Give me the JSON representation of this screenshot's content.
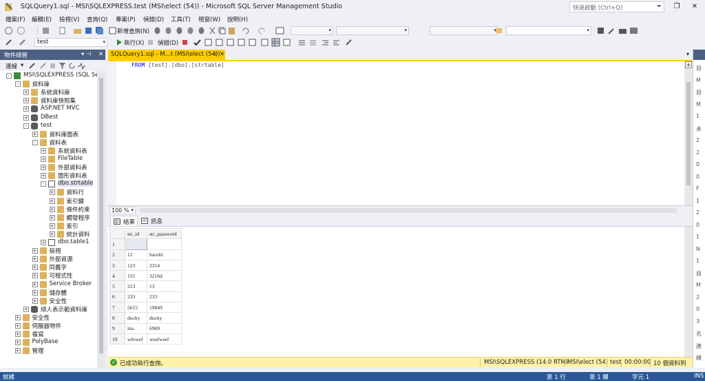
{
  "window": {
    "title": "SQLQuery1.sql - MSI\\SQLEXPRESS.test (MSI\\elect (54)) - Microsoft SQL Server Management Studio",
    "quick_launch_placeholder": "快速啟動 (Ctrl+Q)"
  },
  "menu": [
    "檔案(F)",
    "編輯(E)",
    "檢視(V)",
    "查詢(Q)",
    "專案(P)",
    "偵錯(D)",
    "工具(T)",
    "視窗(W)",
    "說明(H)"
  ],
  "toolbar1": {
    "new_query": "新增查詢(N)"
  },
  "toolbar2": {
    "database": "test",
    "execute": "執行(X)",
    "debug": "偵錯(D)"
  },
  "object_explorer": {
    "title": "物件總管",
    "connect": "連線",
    "tree": [
      {
        "label": "MSI\\SQLEXPRESS (SQL Server",
        "level": 0,
        "expander": "-",
        "icon": "server-icon"
      },
      {
        "label": "資料庫",
        "level": 1,
        "expander": "-",
        "icon": "folder-icon"
      },
      {
        "label": "系統資料庫",
        "level": 2,
        "expander": "+",
        "icon": "folder-icon"
      },
      {
        "label": "資料庫快照集",
        "level": 2,
        "expander": "+",
        "icon": "folder-icon"
      },
      {
        "label": "ASP.NET MVC",
        "level": 2,
        "expander": "+",
        "icon": "database-icon"
      },
      {
        "label": "DBest",
        "level": 2,
        "expander": "+",
        "icon": "database-icon"
      },
      {
        "label": "test",
        "level": 2,
        "expander": "-",
        "icon": "database-icon"
      },
      {
        "label": "資料庫圖表",
        "level": 3,
        "expander": "+",
        "icon": "folder-icon"
      },
      {
        "label": "資料表",
        "level": 3,
        "expander": "-",
        "icon": "folder-icon"
      },
      {
        "label": "系統資料表",
        "level": 4,
        "expander": "+",
        "icon": "folder-icon"
      },
      {
        "label": "FileTable",
        "level": 4,
        "expander": "+",
        "icon": "folder-icon"
      },
      {
        "label": "外部資料表",
        "level": 4,
        "expander": "+",
        "icon": "folder-icon"
      },
      {
        "label": "圖形資料表",
        "level": 4,
        "expander": "+",
        "icon": "folder-icon"
      },
      {
        "label": "dbo.strtable",
        "level": 4,
        "expander": "-",
        "icon": "table-icon",
        "selected": true
      },
      {
        "label": "資料行",
        "level": 5,
        "expander": "+",
        "icon": "folder-icon"
      },
      {
        "label": "索引鍵",
        "level": 5,
        "expander": "+",
        "icon": "folder-icon"
      },
      {
        "label": "條件約束",
        "level": 5,
        "expander": "+",
        "icon": "folder-icon"
      },
      {
        "label": "觸發程序",
        "level": 5,
        "expander": "+",
        "icon": "folder-icon"
      },
      {
        "label": "索引",
        "level": 5,
        "expander": "+",
        "icon": "folder-icon"
      },
      {
        "label": "統計資料",
        "level": 5,
        "expander": "+",
        "icon": "folder-icon"
      },
      {
        "label": "dbo.table1",
        "level": 4,
        "expander": "+",
        "icon": "table-icon"
      },
      {
        "label": "檢視",
        "level": 3,
        "expander": "+",
        "icon": "folder-icon"
      },
      {
        "label": "外部資源",
        "level": 3,
        "expander": "+",
        "icon": "folder-icon"
      },
      {
        "label": "同義字",
        "level": 3,
        "expander": "+",
        "icon": "folder-icon"
      },
      {
        "label": "可程式性",
        "level": 3,
        "expander": "+",
        "icon": "folder-icon"
      },
      {
        "label": "Service Broker",
        "level": 3,
        "expander": "+",
        "icon": "folder-icon"
      },
      {
        "label": "儲存體",
        "level": 3,
        "expander": "+",
        "icon": "folder-icon"
      },
      {
        "label": "安全性",
        "level": 3,
        "expander": "+",
        "icon": "folder-icon"
      },
      {
        "label": "總人表示範資料庫",
        "level": 2,
        "expander": "+",
        "icon": "database-icon"
      },
      {
        "label": "安全性",
        "level": 1,
        "expander": "+",
        "icon": "folder-icon"
      },
      {
        "label": "伺服器物件",
        "level": 1,
        "expander": "+",
        "icon": "folder-icon"
      },
      {
        "label": "複寫",
        "level": 1,
        "expander": "+",
        "icon": "folder-icon"
      },
      {
        "label": "PolyBase",
        "level": 1,
        "expander": "+",
        "icon": "folder-icon"
      },
      {
        "label": "管理",
        "level": 1,
        "expander": "+",
        "icon": "folder-icon"
      }
    ]
  },
  "editor": {
    "tab_label": "SQLQuery1.sql - M...t (MSI\\elect (54))",
    "code_keyword": "FROM",
    "code_rest": " [test].[dbo].[strtable]",
    "zoom": "100 %"
  },
  "results": {
    "tabs": [
      "結果",
      "訊息"
    ],
    "columns": [
      "str_id",
      "str_password"
    ],
    "rows": [
      [
        "1",
        "",
        ""
      ],
      [
        "2",
        "12",
        "harold"
      ],
      [
        "3",
        "123",
        "2314"
      ],
      [
        "4",
        "155",
        "3216d"
      ],
      [
        "5",
        "213",
        "13"
      ],
      [
        "6",
        "233",
        "233"
      ],
      [
        "7",
        "5615",
        "19849"
      ],
      [
        "8",
        "ducky",
        "ducky"
      ],
      [
        "9",
        "ina",
        "6969"
      ],
      [
        "10",
        "wfewef",
        "wsefwsef"
      ]
    ]
  },
  "query_status": {
    "message": "已成功執行查詢。",
    "server": "MSI\\SQLEXPRESS (14.0 RTM)",
    "user": "MSI\\elect (54)",
    "database": "test",
    "elapsed": "00:00:00",
    "rows": "10 個資料列"
  },
  "statusbar": {
    "ready": "就緒",
    "line": "第 1 行",
    "col": "第 1 欄",
    "char": "字元 1",
    "ins": "INS"
  },
  "right_panel": {
    "chars": [
      "目",
      "M",
      "目",
      "M",
      "1",
      "未",
      "2",
      "2",
      "0",
      "0",
      "F",
      "1",
      "2",
      "0",
      "1",
      "N",
      "1",
      "目",
      "M",
      "2",
      "0",
      "3",
      "名",
      "連",
      "線"
    ]
  },
  "colors": {
    "accent": "#2b5797",
    "tab_active": "#ffcc00",
    "panel_header": "#4d6082",
    "status_ok": "#fff2a8",
    "keyword": "#0000ff"
  }
}
